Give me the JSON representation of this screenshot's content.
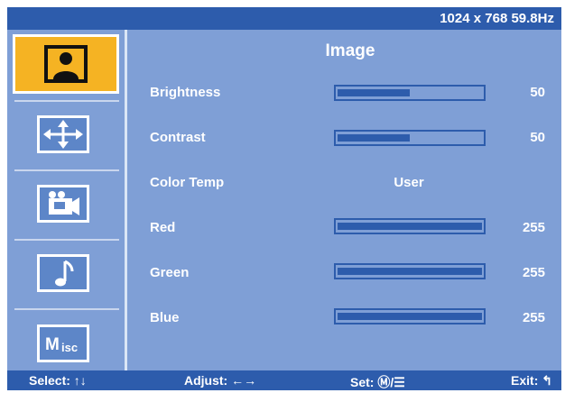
{
  "header": {
    "resolution": "1024 x 768  59.8Hz"
  },
  "sidebar": {
    "items": [
      {
        "name": "image",
        "icon": "image-person-icon",
        "active": true
      },
      {
        "name": "geometry",
        "icon": "move-arrows-icon",
        "active": false
      },
      {
        "name": "video",
        "icon": "video-camera-icon",
        "active": false
      },
      {
        "name": "audio",
        "icon": "music-note-icon",
        "active": false
      },
      {
        "name": "misc",
        "icon": "misc-icon",
        "label": "Misc",
        "active": false
      }
    ]
  },
  "main": {
    "title": "Image",
    "rows": [
      {
        "label": "Brightness",
        "type": "bar",
        "value": "50",
        "max": 100
      },
      {
        "label": "Contrast",
        "type": "bar",
        "value": "50",
        "max": 100
      },
      {
        "label": "Color Temp",
        "type": "text",
        "value": "User"
      },
      {
        "label": "Red",
        "type": "bar",
        "value": "255",
        "max": 255
      },
      {
        "label": "Green",
        "type": "bar",
        "value": "255",
        "max": 255
      },
      {
        "label": "Blue",
        "type": "bar",
        "value": "255",
        "max": 255
      }
    ]
  },
  "footer": {
    "select": "Select: ↑↓",
    "adjust": "Adjust: ←→",
    "set": "Set: Ⓜ/☰",
    "exit": "Exit: ↰"
  },
  "colors": {
    "panel": "#7f9fd6",
    "bar": "#2d5cac",
    "active": "#f5b323"
  }
}
